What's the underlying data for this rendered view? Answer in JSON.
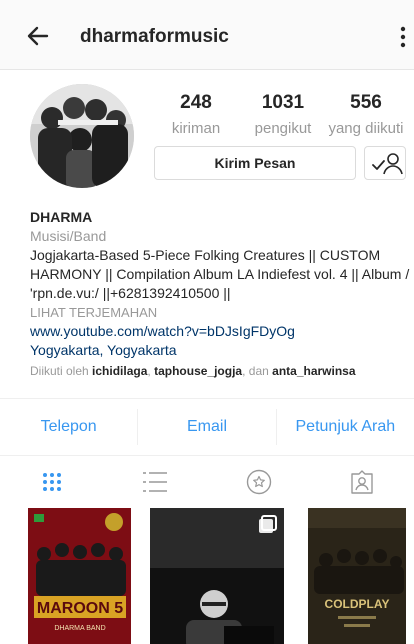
{
  "header": {
    "username": "dharmaformusic",
    "back_icon": "arrow-left-icon",
    "more_icon": "vertical-dots-icon"
  },
  "stats": [
    {
      "value": "248",
      "label": "kiriman"
    },
    {
      "value": "1031",
      "label": "pengikut"
    },
    {
      "value": "556",
      "label": "yang diikuti"
    }
  ],
  "actions": {
    "message_label": "Kirim Pesan",
    "follow_icon": "user-check-icon"
  },
  "bio": {
    "name": "DHARMA",
    "category": "Musisi/Band",
    "description_line1": "Jogjakarta-Based 5-Piece Folking Creatures || CUSTOM",
    "description_line2": "HARMONY || Compilation Album LA Indiefest vol. 4 || Album /",
    "description_line3": "'rpn.de.vu:/ ||+6281392410500 ||",
    "translate": "LIHAT TERJEMAHAN",
    "link": "www.youtube.com/watch?v=bDJsIgFDyOg",
    "location": "Yogyakarta, Yogyakarta",
    "followed_prefix": "Diikuti oleh",
    "followed_by_1": "ichidilaga",
    "followed_by_2": "taphouse_jogja",
    "followed_conj": "dan",
    "followed_by_3": "anta_harwinsa"
  },
  "contact": {
    "phone": "Telepon",
    "email": "Email",
    "directions": "Petunjuk Arah"
  },
  "tabs": [
    {
      "icon": "grid-icon",
      "active": true
    },
    {
      "icon": "list-icon",
      "active": false
    },
    {
      "icon": "star-circle-icon",
      "active": false
    },
    {
      "icon": "tagged-person-icon",
      "active": false
    }
  ],
  "posts": [
    {
      "title": "MAROON 5",
      "subtitle": "DHARMA BAND"
    },
    {
      "title": "",
      "subtitle": ""
    },
    {
      "title": "COLDPLAY",
      "subtitle": ""
    }
  ],
  "colors": {
    "accent": "#3897f0",
    "link": "#003569",
    "muted": "#999999",
    "text": "#262626"
  }
}
